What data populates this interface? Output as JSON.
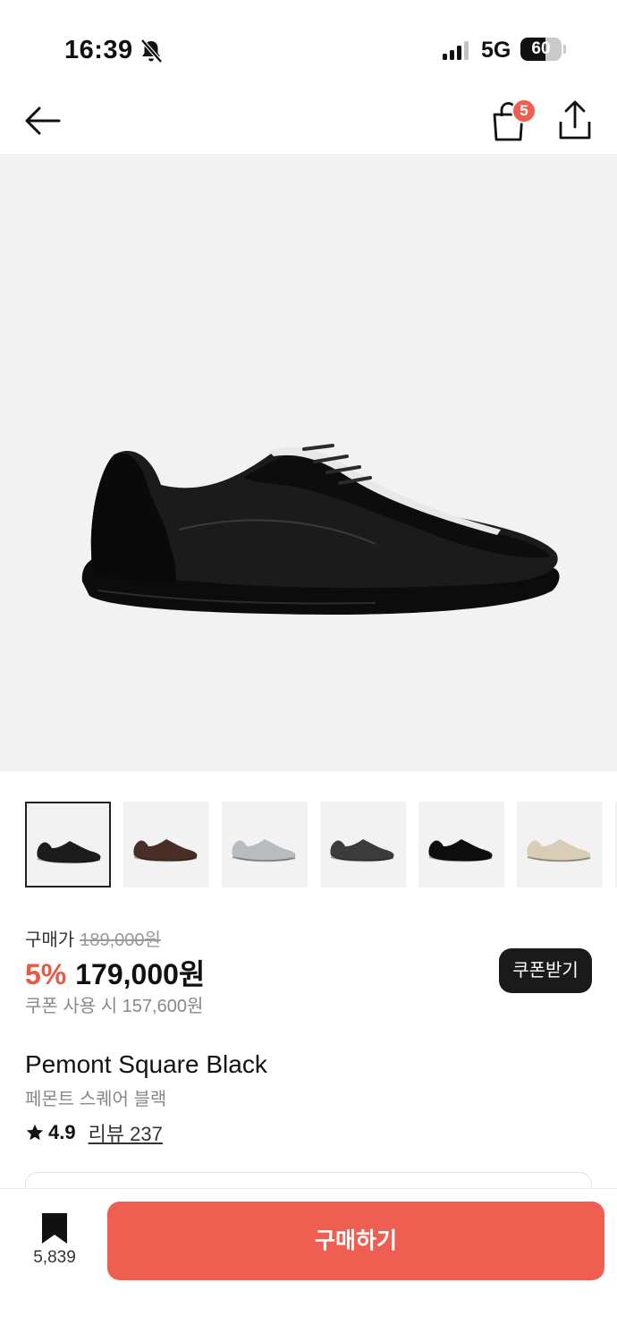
{
  "status_bar": {
    "time": "16:39",
    "network": "5G",
    "battery_level": "60",
    "battery_fraction": 0.6
  },
  "nav": {
    "back_icon": "arrow-left-icon",
    "cart_icon": "shopping-bag-icon",
    "cart_badge": "5",
    "share_icon": "share-upload-icon"
  },
  "hero": {
    "image": "black-sneaker-photo"
  },
  "thumbnails": [
    {
      "name": "black",
      "color": "#1c1c1c",
      "selected": true
    },
    {
      "name": "brown",
      "color": "#4a2e26",
      "selected": false
    },
    {
      "name": "silver",
      "color": "#b9bcbf",
      "selected": false
    },
    {
      "name": "dark-grey",
      "color": "#3b3b3b",
      "selected": false
    },
    {
      "name": "black-suede",
      "color": "#0e0e0e",
      "selected": false
    },
    {
      "name": "beige",
      "color": "#d9cdb5",
      "selected": false
    }
  ],
  "price": {
    "label": "구매가",
    "original": "189,000원",
    "discount": "5%",
    "current": "179,000원",
    "coupon_note": "쿠폰 사용 시 157,600원",
    "coupon_button": "쿠폰받기"
  },
  "product": {
    "name": "Pemont Square Black",
    "name_ko": "페몬트 스퀘어 블랙",
    "rating": "4.9",
    "review_link": "리뷰 237"
  },
  "bottom_bar": {
    "bookmark_count": "5,839",
    "buy_label": "구매하기"
  },
  "colors": {
    "accent": "#ef5f51",
    "discount": "#e85846",
    "dark_button": "#1a1a1a"
  }
}
